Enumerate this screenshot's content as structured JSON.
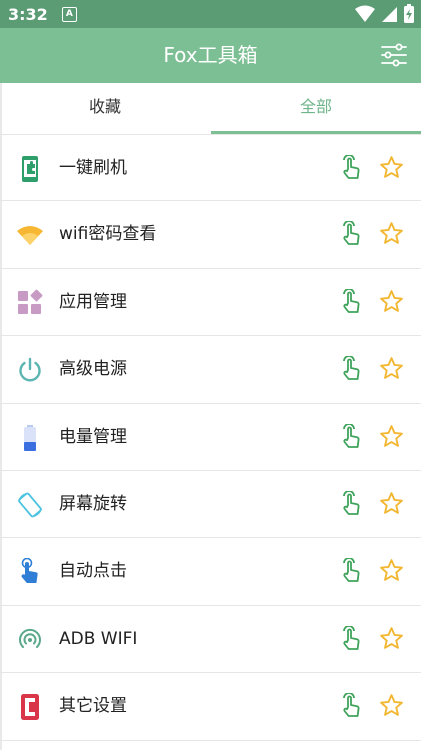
{
  "status": {
    "time": "3:32",
    "notif_glyph": "A"
  },
  "appbar": {
    "title": "Fox工具箱"
  },
  "tabs": [
    {
      "label": "收藏"
    },
    {
      "label": "全部"
    }
  ],
  "items": [
    {
      "label": "一键刷机",
      "icon": "phone-puzzle-icon"
    },
    {
      "label": "wifi密码查看",
      "icon": "wifi-icon"
    },
    {
      "label": "应用管理",
      "icon": "apps-grid-icon"
    },
    {
      "label": "高级电源",
      "icon": "power-icon"
    },
    {
      "label": "电量管理",
      "icon": "battery-icon"
    },
    {
      "label": "屏幕旋转",
      "icon": "screen-rotation-icon"
    },
    {
      "label": "自动点击",
      "icon": "auto-click-icon"
    },
    {
      "label": "ADB WIFI",
      "icon": "adb-wifi-icon"
    },
    {
      "label": "其它设置",
      "icon": "other-settings-icon"
    }
  ],
  "colors": {
    "appbar": "#7dbf94",
    "statusbar": "#5b9c74",
    "accent_green": "#3fa35b",
    "star": "#f2b630"
  }
}
